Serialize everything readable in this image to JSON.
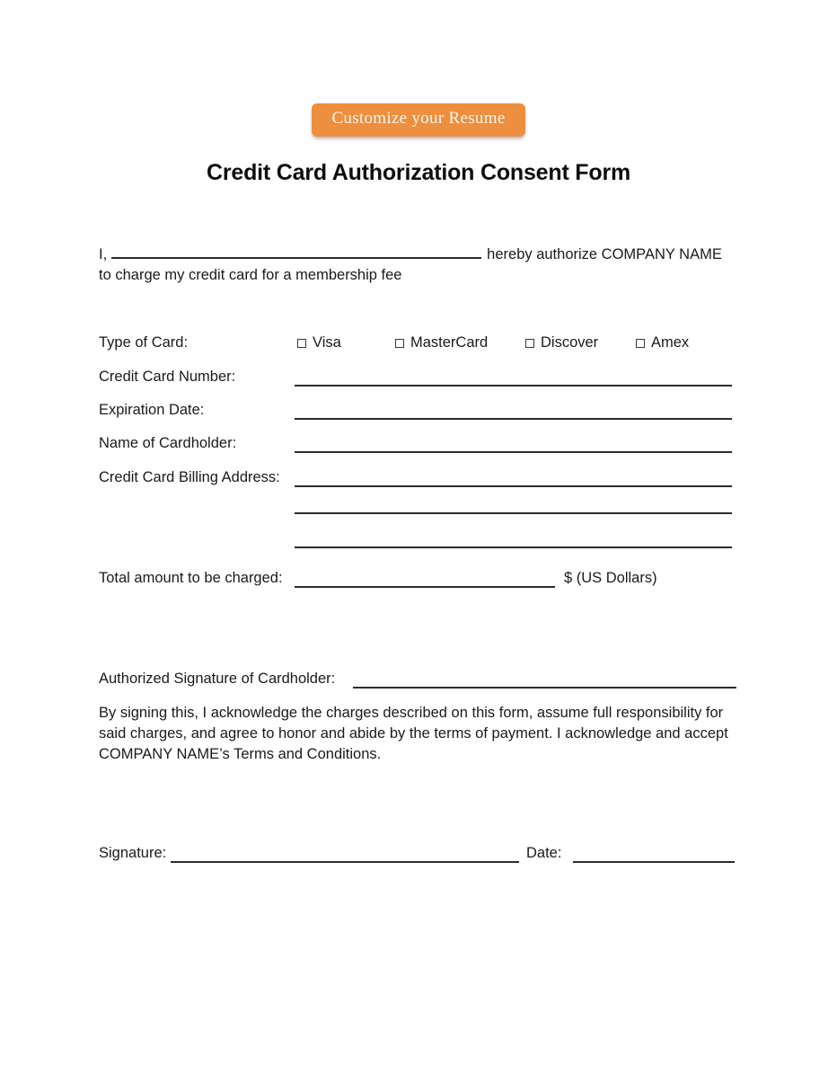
{
  "cta": {
    "label": "Customize your Resume",
    "bg_color": "#ed8f3f",
    "text_color": "#fdf6ef"
  },
  "document": {
    "title": "Credit Card Authorization Consent Form",
    "intro": {
      "prefix": "I,",
      "suffix": "hereby authorize COMPANY NAME",
      "line2": "to charge my credit card for a membership fee"
    },
    "card_type": {
      "label": "Type of Card:",
      "options": [
        {
          "name": "Visa"
        },
        {
          "name": "MasterCard"
        },
        {
          "name": "Discover"
        },
        {
          "name": "Amex"
        }
      ]
    },
    "fields": {
      "credit_card_number": "Credit Card Number:",
      "expiration_date": "Expiration Date:",
      "name_of_cardholder": "Name of Cardholder:",
      "billing_address": "Credit Card Billing Address:"
    },
    "total": {
      "label": "Total amount to be charged:",
      "suffix": "$ (US Dollars)"
    },
    "authorized_signature_label": "Authorized Signature of Cardholder:",
    "consent_paragraph": "By signing this, I acknowledge the charges described on this form, assume full responsibility for said charges, and agree to honor and abide by the terms of payment. I acknowledge and accept COMPANY NAME’s Terms and Conditions.",
    "signature_label": "Signature:",
    "date_label": "Date:"
  }
}
